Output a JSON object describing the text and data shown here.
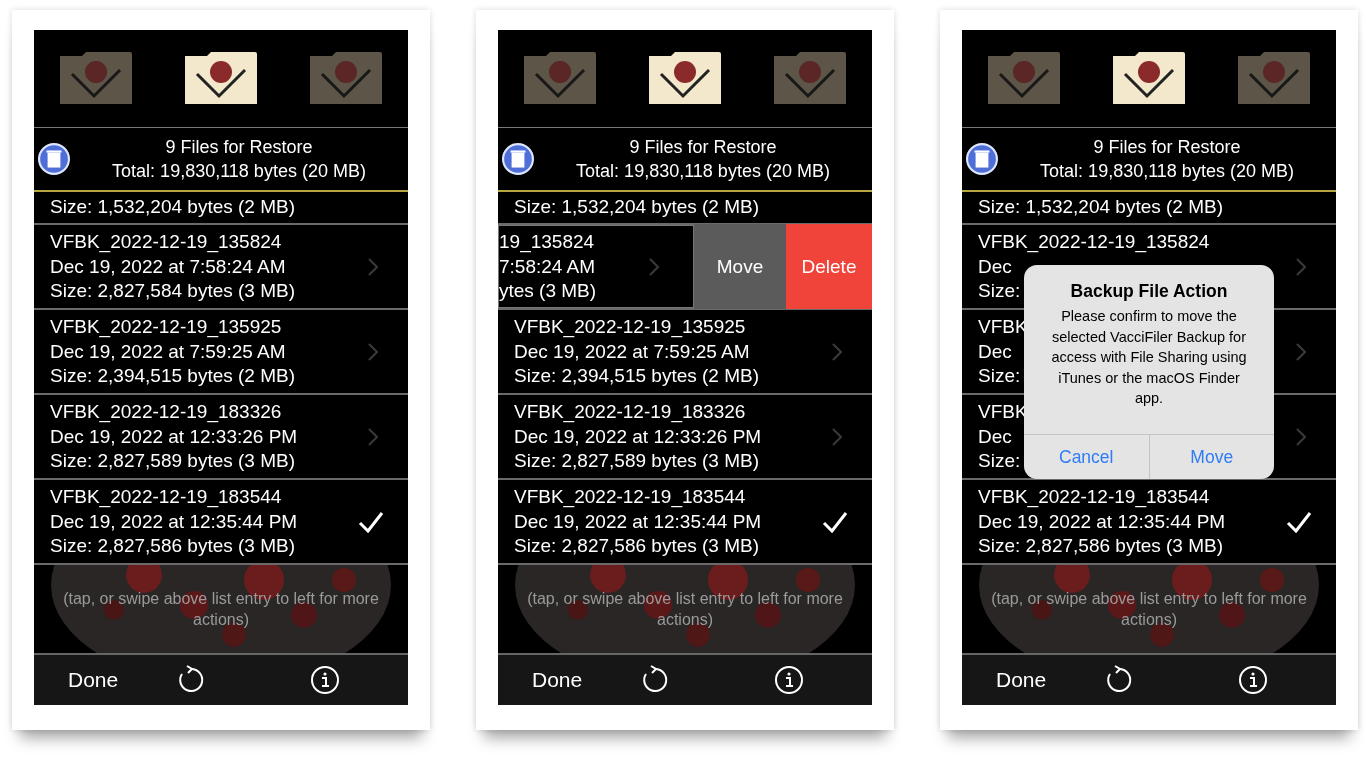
{
  "panels": [
    {
      "folders": [
        {
          "selected": false
        },
        {
          "selected": true
        },
        {
          "selected": false
        }
      ],
      "header": {
        "title": "9 Files for Restore",
        "total": "Total: 19,830,118 bytes (20 MB)"
      },
      "top_row": "Size: 1,532,204 bytes (2 MB)",
      "rows": [
        {
          "kind": "normal",
          "lines": [
            "VFBK_2022-12-19_135824",
            "Dec 19, 2022 at 7:58:24 AM",
            "Size: 2,827,584 bytes (3 MB)"
          ],
          "checked": false
        },
        {
          "kind": "normal",
          "lines": [
            "VFBK_2022-12-19_135925",
            "Dec 19, 2022 at 7:59:25 AM",
            "Size: 2,394,515 bytes (2 MB)"
          ],
          "checked": false
        },
        {
          "kind": "normal",
          "lines": [
            "VFBK_2022-12-19_183326",
            "Dec 19, 2022 at 12:33:26 PM",
            "Size: 2,827,589 bytes (3 MB)"
          ],
          "checked": false
        },
        {
          "kind": "normal",
          "lines": [
            "VFBK_2022-12-19_183544",
            "Dec 19, 2022 at 12:35:44 PM",
            "Size: 2,827,586 bytes (3 MB)"
          ],
          "checked": true
        }
      ],
      "hint": "(tap, or swipe above list entry to left for more actions)",
      "toolbar": {
        "done": "Done"
      }
    },
    {
      "folders": [
        {
          "selected": false
        },
        {
          "selected": true
        },
        {
          "selected": false
        }
      ],
      "header": {
        "title": "9 Files for Restore",
        "total": "Total: 19,830,118 bytes (20 MB)"
      },
      "top_row": "Size: 1,532,204 bytes (2 MB)",
      "rows": [
        {
          "kind": "swiped",
          "lines": [
            "19_135824",
            "7:58:24 AM",
            "ytes (3 MB)"
          ],
          "checked": false,
          "actions": [
            {
              "label": "Move",
              "kind": "move"
            },
            {
              "label": "Delete",
              "kind": "delete"
            }
          ]
        },
        {
          "kind": "normal",
          "lines": [
            "VFBK_2022-12-19_135925",
            "Dec 19, 2022 at 7:59:25 AM",
            "Size: 2,394,515 bytes (2 MB)"
          ],
          "checked": false
        },
        {
          "kind": "normal",
          "lines": [
            "VFBK_2022-12-19_183326",
            "Dec 19, 2022 at 12:33:26 PM",
            "Size: 2,827,589 bytes (3 MB)"
          ],
          "checked": false
        },
        {
          "kind": "normal",
          "lines": [
            "VFBK_2022-12-19_183544",
            "Dec 19, 2022 at 12:35:44 PM",
            "Size: 2,827,586 bytes (3 MB)"
          ],
          "checked": true
        }
      ],
      "hint": "(tap, or swipe above list entry to left for more actions)",
      "toolbar": {
        "done": "Done"
      }
    },
    {
      "folders": [
        {
          "selected": false
        },
        {
          "selected": true
        },
        {
          "selected": false
        }
      ],
      "header": {
        "title": "9 Files for Restore",
        "total": "Total: 19,830,118 bytes (20 MB)"
      },
      "top_row": "Size: 1,532,204 bytes (2 MB)",
      "rows": [
        {
          "kind": "normal",
          "lines": [
            "VFBK_2022-12-19_135824",
            "Dec",
            "Size:"
          ],
          "checked": false
        },
        {
          "kind": "normal",
          "lines": [
            "VFBK",
            "Dec",
            "Size:"
          ],
          "checked": false
        },
        {
          "kind": "normal",
          "lines": [
            "VFBK",
            "Dec",
            "Size:"
          ],
          "checked": false
        },
        {
          "kind": "normal",
          "lines": [
            "VFBK_2022-12-19_183544",
            "Dec 19, 2022 at 12:35:44 PM",
            "Size: 2,827,586 bytes (3 MB)"
          ],
          "checked": true
        }
      ],
      "dialog": {
        "title": "Backup File Action",
        "message": "Please confirm to move the selected VacciFiler Backup for access with File Sharing using iTunes or the macOS Finder app.",
        "buttons": [
          "Cancel",
          "Move"
        ]
      },
      "hint": "(tap, or swipe above list entry to left for more actions)",
      "toolbar": {
        "done": "Done"
      }
    }
  ]
}
